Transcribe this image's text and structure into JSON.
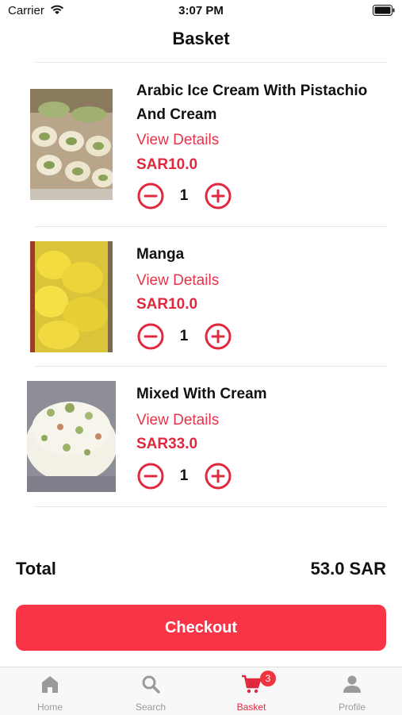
{
  "status_bar": {
    "carrier": "Carrier",
    "time": "3:07 PM"
  },
  "header": {
    "title": "Basket"
  },
  "items": [
    {
      "name": "Arabic Ice Cream With Pistachio And Cream",
      "view_details": "View Details",
      "price": "SAR10.0",
      "quantity": "1"
    },
    {
      "name": "Manga",
      "view_details": "View Details",
      "price": "SAR10.0",
      "quantity": "1"
    },
    {
      "name": "Mixed With Cream",
      "view_details": "View Details",
      "price": "SAR33.0",
      "quantity": "1"
    }
  ],
  "summary": {
    "total_label": "Total",
    "total_value": "53.0 SAR"
  },
  "checkout": {
    "label": "Checkout"
  },
  "tabbar": {
    "tabs": [
      {
        "label": "Home",
        "icon": "home-icon"
      },
      {
        "label": "Search",
        "icon": "search-icon"
      },
      {
        "label": "Basket",
        "icon": "cart-icon",
        "badge": "3",
        "active": true
      },
      {
        "label": "Profile",
        "icon": "person-icon"
      }
    ]
  },
  "colors": {
    "accent": "#fa3447",
    "price": "#e0283f",
    "link": "#e8334a",
    "inactive_tab": "#9a9a9a"
  }
}
